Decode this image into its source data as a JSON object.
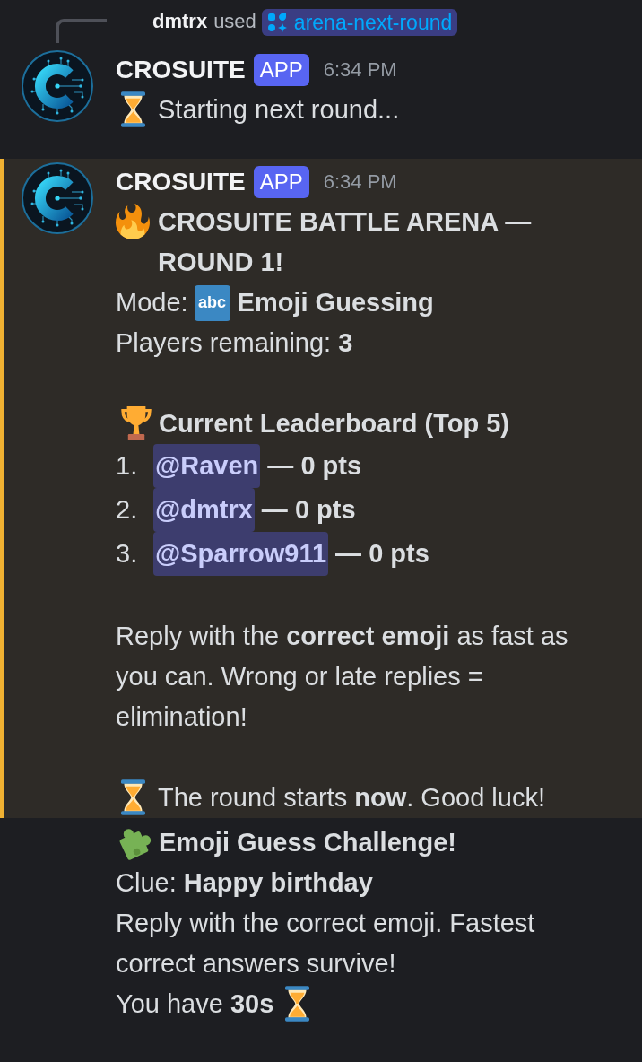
{
  "messages": [
    {
      "reply": {
        "user": "dmtrx",
        "action": "used",
        "command": "arena-next-round"
      },
      "author": "CROSUITE",
      "tag": "APP",
      "time": "6:34 PM",
      "highlighted": false,
      "lines": [
        {
          "kind": "status",
          "text": "Starting next round..."
        }
      ]
    },
    {
      "author": "CROSUITE",
      "tag": "APP",
      "time": "6:34 PM",
      "highlighted": true,
      "lines": [
        {
          "kind": "heading",
          "text": "CROSUITE BATTLE ARENA — ROUND 1!"
        },
        {
          "kind": "mode",
          "label": "Mode:",
          "emoji_text": "abc",
          "value": "Emoji Guessing"
        },
        {
          "kind": "plain",
          "text": "Players remaining: **3**"
        },
        {
          "kind": "gap"
        },
        {
          "kind": "trophy",
          "text": "Current Leaderboard (Top 5)"
        },
        {
          "kind": "rank",
          "number": "1.",
          "mention": "@Raven",
          "score": "— 0 pts"
        },
        {
          "kind": "rank",
          "number": "2.",
          "mention": "@dmtrx",
          "score": "— 0 pts"
        },
        {
          "kind": "rank",
          "number": "3.",
          "mention": "@Sparrow911",
          "score": "— 0 pts"
        },
        {
          "kind": "gap"
        },
        {
          "kind": "plain",
          "text": "Reply with the **correct emoji** as fast as you can. Wrong or late replies = elimination!"
        },
        {
          "kind": "gap"
        },
        {
          "kind": "status",
          "text": "The round starts **now**. Good luck!"
        }
      ]
    },
    {
      "highlighted": false,
      "lines": [
        {
          "kind": "puzzle",
          "text": "Emoji Guess Challenge!"
        },
        {
          "kind": "plain",
          "text": "Clue: **Happy birthday**"
        },
        {
          "kind": "plain",
          "text": "Reply with the correct emoji. Fastest correct answers survive!"
        },
        {
          "kind": "countdown",
          "text": "You have **30s**"
        }
      ]
    }
  ]
}
